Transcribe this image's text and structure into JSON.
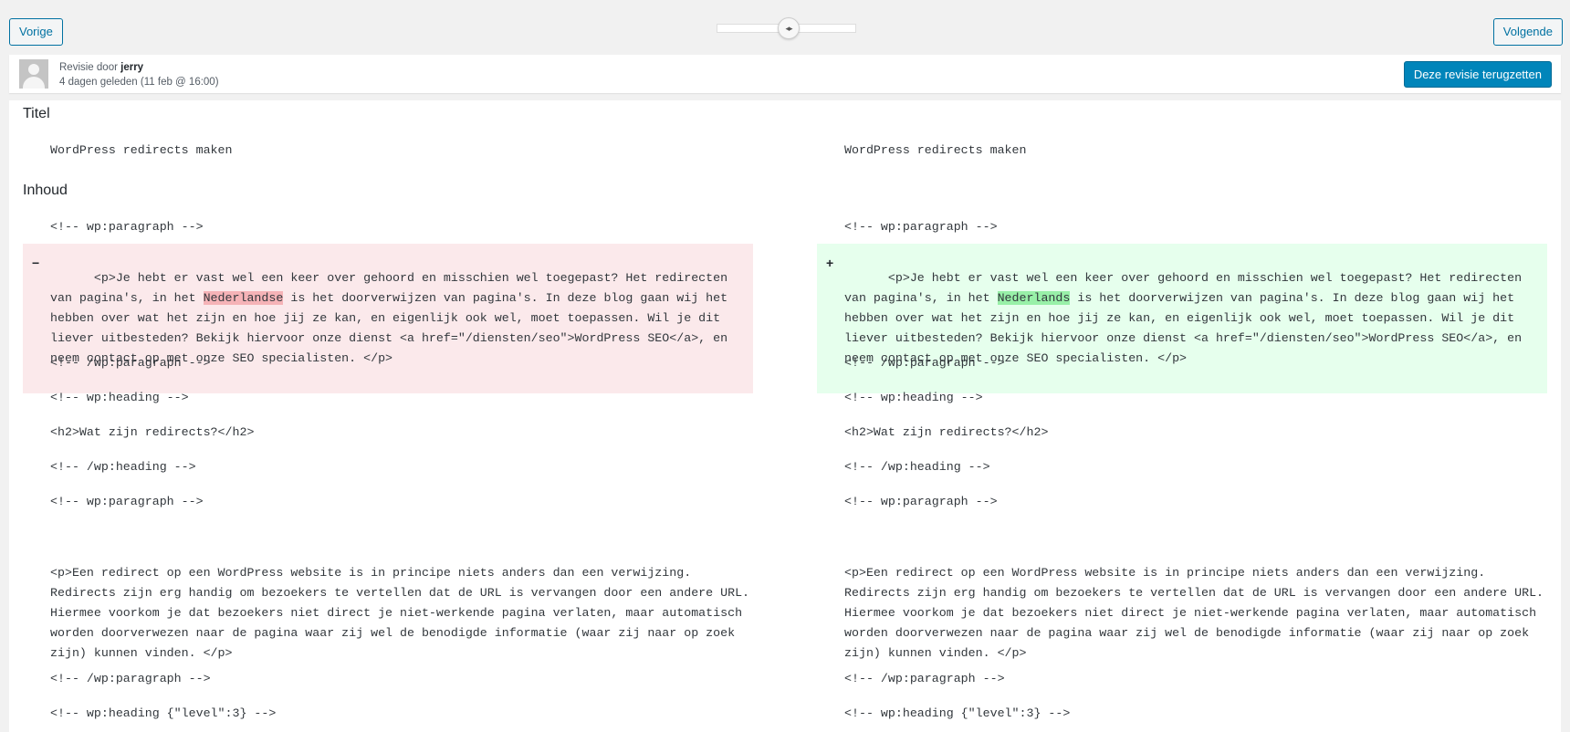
{
  "nav": {
    "prev_label": "Vorige",
    "next_label": "Volgende"
  },
  "slider": {
    "handle_icon": "arrows-left-right-icon",
    "handle_glyph": "◂▸"
  },
  "meta": {
    "author_prefix": "Revisie door ",
    "author": "jerry",
    "relative_time": "4 dagen geleden",
    "absolute_time": "(11 feb @ 16:00)",
    "restore_label": "Deze revisie terugzetten"
  },
  "diff": {
    "title_heading": "Titel",
    "content_heading": "Inhoud",
    "title_left": "WordPress redirects maken",
    "title_right": "WordPress redirects maken",
    "lines": {
      "l1": "<!-- wp:paragraph -->",
      "changed_left_pre": "<p>Je hebt er vast wel een keer over gehoord en misschien wel toegepast? Het redirecten van pagina's, in het ",
      "changed_left_word": "Nederlandse",
      "changed_left_post": " is het doorverwijzen van pagina's. In deze blog gaan wij het hebben over wat het zijn en hoe jij ze kan, en eigenlijk ook wel, moet toepassen. Wil je dit liever uitbesteden? Bekijk hiervoor onze dienst <a href=\"/diensten/seo\">WordPress SEO</a>, en neem contact op met onze SEO specialisten. </p>",
      "changed_right_pre": "<p>Je hebt er vast wel een keer over gehoord en misschien wel toegepast? Het redirecten van pagina's, in het ",
      "changed_right_word": "Nederlands",
      "changed_right_post": " is het doorverwijzen van pagina's. In deze blog gaan wij het hebben over wat het zijn en hoe jij ze kan, en eigenlijk ook wel, moet toepassen. Wil je dit liever uitbesteden? Bekijk hiervoor onze dienst <a href=\"/diensten/seo\">WordPress SEO</a>, en neem contact op met onze SEO specialisten. </p>",
      "minus": "−",
      "plus": "+",
      "l3": "<!-- /wp:paragraph -->",
      "l4": "<!-- wp:heading -->",
      "l5": "<h2>Wat zijn redirects?</h2>",
      "l6": "<!-- /wp:heading -->",
      "l7": "<!-- wp:paragraph -->",
      "l8": "<p>Een redirect op een WordPress website is in principe niets anders dan een verwijzing. Redirects zijn erg handig om bezoekers te vertellen dat de URL is vervangen door een andere URL. Hiermee voorkom je dat bezoekers niet direct je niet-werkende pagina verlaten, maar automatisch worden doorverwezen naar de pagina waar zij wel de benodigde informatie (waar zij naar op zoek zijn) kunnen vinden. </p>",
      "l9": "<!-- /wp:paragraph -->",
      "l10": "<!-- wp:heading {\"level\":3} -->"
    }
  }
}
